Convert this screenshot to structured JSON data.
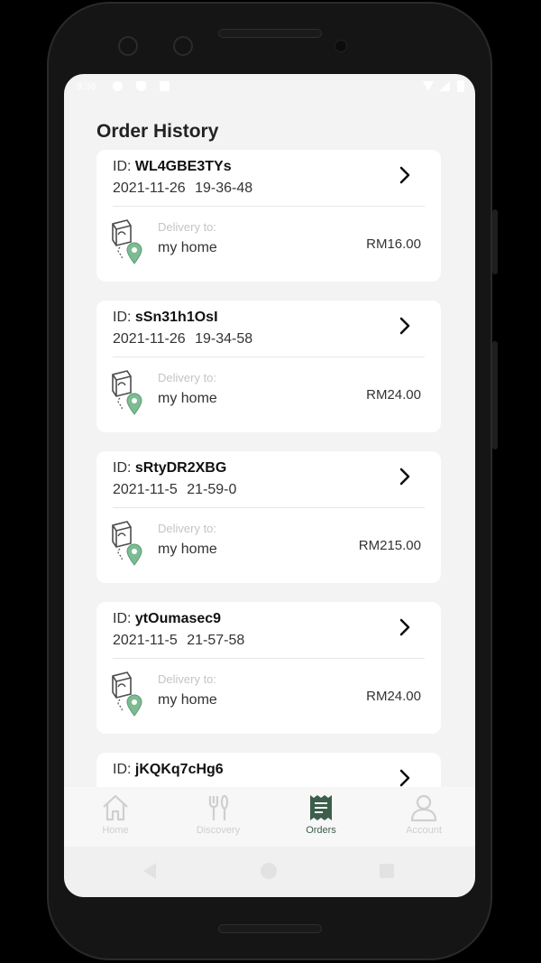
{
  "status_bar": {
    "time": "9:38",
    "icons": [
      "settings-icon",
      "shield-icon",
      "clipboard-icon",
      "wifi-icon",
      "signal-icon",
      "battery-icon"
    ]
  },
  "page": {
    "title": "Order History"
  },
  "orders": [
    {
      "id_prefix": "ID:",
      "id": "WL4GBE3TYs",
      "datetime": "2021-11-26 19-36-48",
      "delivery_label": "Delivery to:",
      "delivery_place": "my home",
      "price": "RM16.00"
    },
    {
      "id_prefix": "ID:",
      "id": "sSn31h1OsI",
      "datetime": "2021-11-26 19-34-58",
      "delivery_label": "Delivery to:",
      "delivery_place": "my home",
      "price": "RM24.00"
    },
    {
      "id_prefix": "ID:",
      "id": "sRtyDR2XBG",
      "datetime": "2021-11-5 21-59-0",
      "delivery_label": "Delivery to:",
      "delivery_place": "my home",
      "price": "RM215.00"
    },
    {
      "id_prefix": "ID:",
      "id": "ytOumasec9",
      "datetime": "2021-11-5 21-57-58",
      "delivery_label": "Delivery to:",
      "delivery_place": "my home",
      "price": "RM24.00"
    },
    {
      "id_prefix": "ID:",
      "id": "jKQKq7cHg6",
      "datetime": "",
      "delivery_label": "",
      "delivery_place": "",
      "price": ""
    }
  ],
  "tabs": [
    {
      "label": "Home",
      "icon": "home-icon",
      "active": false
    },
    {
      "label": "Discovery",
      "icon": "fork-knife-icon",
      "active": false
    },
    {
      "label": "Orders",
      "icon": "receipt-icon",
      "active": true
    },
    {
      "label": "Account",
      "icon": "person-icon",
      "active": false
    }
  ],
  "colors": {
    "accent": "#3d5e4b",
    "bag_icon": "#6aa882",
    "background": "#f3f3f3",
    "card": "#ffffff",
    "inactive_tab": "#cfcfcf"
  }
}
